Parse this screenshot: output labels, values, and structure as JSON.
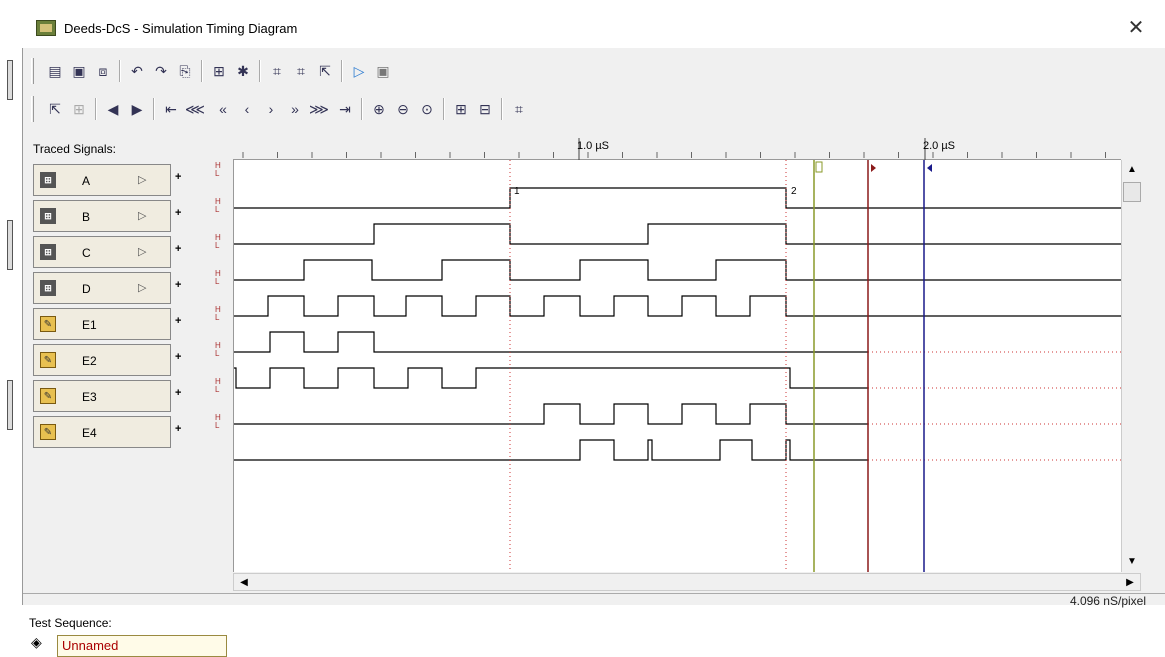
{
  "window": {
    "title": "Deeds-DcS  -  Simulation Timing Diagram",
    "close_icon": "close-icon"
  },
  "toolbar1": [
    "print-icon",
    "save-icon",
    "export-icon",
    "undo-icon",
    "redo-icon",
    "copy-icon",
    "zoom-signal-icon",
    "settings-icon",
    "chip-icon",
    "chip-add-icon",
    "pointer-icon",
    "play-icon",
    "stop-icon"
  ],
  "toolbar2": [
    "select-icon",
    "grid-icon",
    "arrow-left-icon",
    "arrow-right-icon",
    "go-start-icon",
    "fast-back3-icon",
    "fast-back2-icon",
    "back-icon",
    "forward-icon",
    "fast-forward2-icon",
    "fast-forward3-icon",
    "go-end-icon",
    "zoom-in-icon",
    "zoom-out-icon",
    "zoom-fit-icon",
    "measure-icon",
    "measure2-icon",
    "chip-view-icon"
  ],
  "signals_panel": {
    "label": "Traced Signals:",
    "signals": [
      {
        "name": "A",
        "kind": "input"
      },
      {
        "name": "B",
        "kind": "input"
      },
      {
        "name": "C",
        "kind": "input"
      },
      {
        "name": "D",
        "kind": "input"
      },
      {
        "name": "E1",
        "kind": "output"
      },
      {
        "name": "E2",
        "kind": "output"
      },
      {
        "name": "E3",
        "kind": "output"
      },
      {
        "name": "E4",
        "kind": "output"
      }
    ],
    "hl_high": "H",
    "hl_low": "L"
  },
  "test_sequence": {
    "label": "Test Sequence:",
    "value": "Unnamed"
  },
  "ruler": {
    "tick1": "1.0 µS",
    "tick2": "2.0 µS"
  },
  "markers": {
    "m1": "1",
    "m2": "2"
  },
  "colors": {
    "marker_green": "#8a9a2a",
    "marker_red": "#8b1a1a",
    "marker_blue": "#1a1a8a",
    "dotted": "#cc3333"
  },
  "status": {
    "resolution": "4.096 nS/pixel"
  }
}
